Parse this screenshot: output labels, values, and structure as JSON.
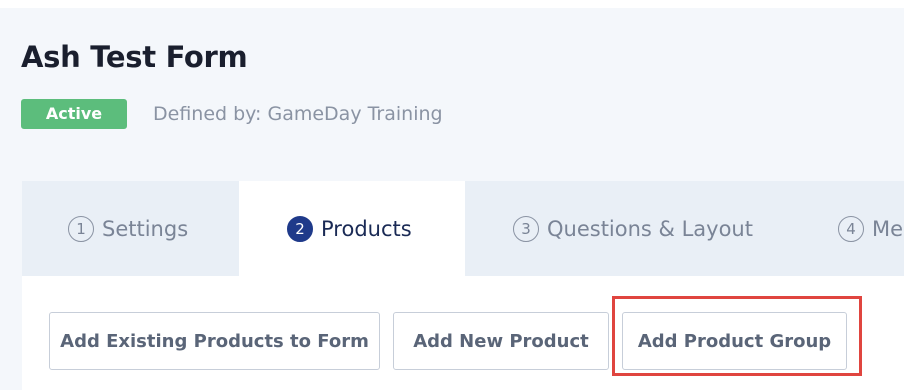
{
  "form": {
    "title": "Ash Test Form",
    "status_badge": "Active",
    "defined_by": "Defined by: GameDay Training"
  },
  "tabs": [
    {
      "number": "1",
      "label": "Settings",
      "active": false
    },
    {
      "number": "2",
      "label": "Products",
      "active": true
    },
    {
      "number": "3",
      "label": "Questions & Layout",
      "active": false
    },
    {
      "number": "4",
      "label": "Me",
      "active": false
    }
  ],
  "actions": {
    "add_existing": "Add Existing Products to Form",
    "add_new": "Add New Product",
    "add_group": "Add Product Group"
  },
  "colors": {
    "active_badge": "#5cbd7c",
    "active_tab_number": "#1f3a8a",
    "highlight_box": "#e0453f"
  }
}
